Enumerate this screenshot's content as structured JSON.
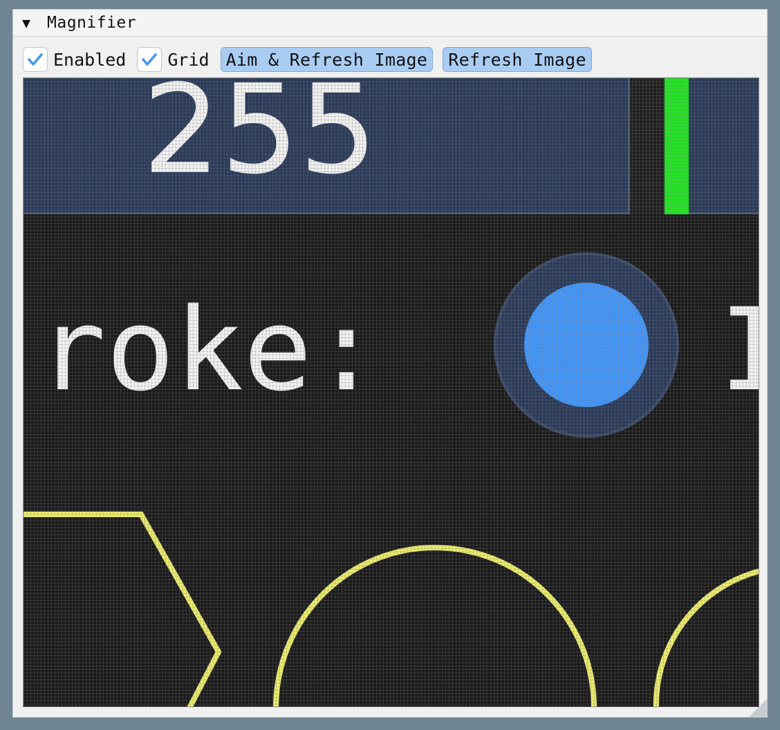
{
  "panel": {
    "title": "Magnifier",
    "collapse_icon": "▼"
  },
  "toolbar": {
    "enabled_label": "Enabled",
    "enabled_checked": true,
    "grid_label": "Grid",
    "grid_checked": true,
    "aim_refresh_label": "Aim & Refresh Image",
    "refresh_label": "Refresh Image"
  },
  "magnified_content": {
    "value_text": "255",
    "stroke_label_text": "roke:",
    "cut_off_char": "I"
  },
  "colors": {
    "accent_blue": "#4296fa",
    "slider_bg": "#2b3b5a",
    "green_bar": "#22e622",
    "shape_yellow": "#ebeb6c",
    "viewport_bg": "#1b1b1b"
  }
}
